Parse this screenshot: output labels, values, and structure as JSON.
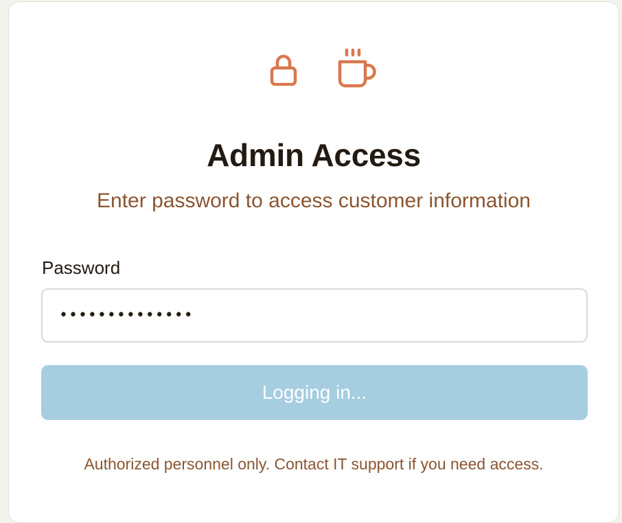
{
  "header": {
    "icons": [
      "lock-icon",
      "coffee-icon"
    ],
    "title": "Admin Access",
    "subtitle": "Enter password to access customer information"
  },
  "form": {
    "password_label": "Password",
    "password_value": "••••••••••••••",
    "submit_label": "Logging in...",
    "submit_state": "loading"
  },
  "footer": {
    "note": "Authorized personnel only. Contact IT support if you need access."
  },
  "colors": {
    "accent": "#d9784f",
    "title": "#231a12",
    "subtitle": "#8a5530",
    "button_disabled": "#a6cde0",
    "border": "#dcdad4"
  }
}
